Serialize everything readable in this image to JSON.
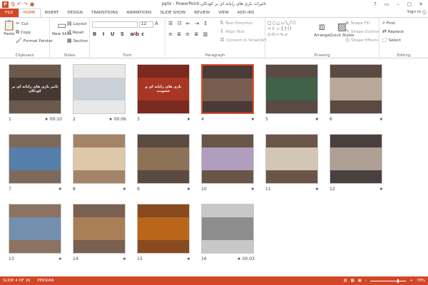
{
  "titlebar": {
    "title": "تاثیرات بازی های رایانه ای بر کودکان.pptx - PowerPoint",
    "logo": "P",
    "qat_icons": [
      "save-icon",
      "undo-icon",
      "redo-icon",
      "start-slideshow-icon"
    ],
    "controls": [
      "?",
      "▭",
      "–",
      "▢",
      "✕"
    ]
  },
  "tabs": [
    "FILE",
    "HOME",
    "INSERT",
    "DESIGN",
    "TRANSITIONS",
    "ANIMATIONS",
    "SLIDE SHOW",
    "REVIEW",
    "VIEW",
    "ADD-INS"
  ],
  "active_tab": "HOME",
  "signin": "Sign in",
  "ribbon": {
    "clipboard": {
      "label": "Clipboard",
      "paste": "Paste",
      "cut": "Cut",
      "copy": "Copy",
      "format_painter": "Format Painter"
    },
    "slides": {
      "label": "Slides",
      "new_slide": "New Slide",
      "layout": "Layout",
      "reset": "Reset",
      "section": "Section"
    },
    "font": {
      "label": "Font",
      "size": "12"
    },
    "paragraph": {
      "label": "Paragraph",
      "text_direction": "Text Direction",
      "align_text": "Align Text",
      "convert_smartart": "Convert to SmartArt"
    },
    "drawing": {
      "label": "Drawing",
      "arrange": "Arrange",
      "quick_styles": "Quick Styles",
      "shape_fill": "Shape Fill",
      "shape_outline": "Shape Outline",
      "shape_effects": "Shape Effects"
    },
    "editing": {
      "label": "Editing",
      "find": "Find",
      "replace": "Replace",
      "select": "Select"
    }
  },
  "slides": [
    {
      "num": "1",
      "marker": "★ 00:10",
      "title": "تاثیر بازی های رایانه ای بر کودکان",
      "bg": "#6b5a4c",
      "band": "#3a2f28"
    },
    {
      "num": "2",
      "marker": "★ 00:06",
      "title": "",
      "bg": "#e8e8e8",
      "band": "#bfc8d2"
    },
    {
      "num": "3",
      "marker": "★",
      "title": "بازی های رایانه ای و خشونت",
      "bg": "#7a2a1e",
      "band": "#b73b27"
    },
    {
      "num": "4",
      "marker": "★",
      "title": "",
      "bg": "#4a3a38",
      "band": "#8a6a5a"
    },
    {
      "num": "5",
      "marker": "★",
      "title": "",
      "bg": "#5a4a44",
      "band": "#3a6a4a"
    },
    {
      "num": "6",
      "marker": "★",
      "title": "",
      "bg": "#5b4a42",
      "band": "#d8c8b8"
    },
    {
      "num": "7",
      "marker": "★",
      "title": "",
      "bg": "#7d6a5c",
      "band": "#4a86c5"
    },
    {
      "num": "8",
      "marker": "★",
      "title": "",
      "bg": "#a48468",
      "band": "#f0e0c0"
    },
    {
      "num": "9",
      "marker": "★",
      "title": "",
      "bg": "#5a4a40",
      "band": "#a08060"
    },
    {
      "num": "10",
      "marker": "★",
      "title": "",
      "bg": "#6a5648",
      "band": "#c7b7e6"
    },
    {
      "num": "11",
      "marker": "★",
      "title": "",
      "bg": "#6b5548",
      "band": "#f5ecd8"
    },
    {
      "num": "12",
      "marker": "★",
      "title": "",
      "bg": "#4a4040",
      "band": "#d0c0b0"
    },
    {
      "num": "13",
      "marker": "★",
      "title": "",
      "bg": "#8c7262",
      "band": "#6a9ac8"
    },
    {
      "num": "14",
      "marker": "★",
      "title": "",
      "bg": "#7a6050",
      "band": "#b98a5a"
    },
    {
      "num": "15",
      "marker": "★",
      "title": "",
      "bg": "#8a4a20",
      "band": "#c8701a"
    },
    {
      "num": "16",
      "marker": "★ 00:03",
      "title": "",
      "bg": "#c8c8c8",
      "band": "#7a7a7a"
    }
  ],
  "selected_slide": "4",
  "status": {
    "slide": "SLIDE 4 OF 16",
    "language": "PERSIAN",
    "zoom": "78%",
    "zoom_level": 0.78
  },
  "colors": {
    "accent": "#d24726",
    "selected_border": "#e44d2e"
  }
}
